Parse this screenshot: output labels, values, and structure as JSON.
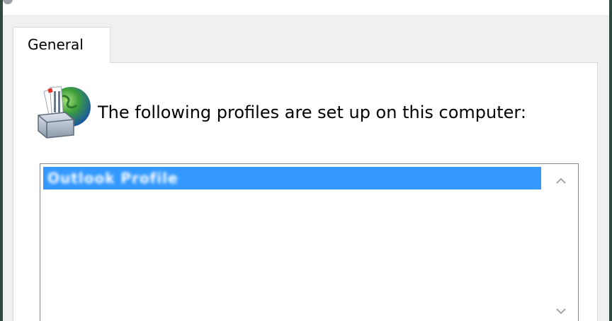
{
  "tab": {
    "label": "General"
  },
  "heading": "The following profiles are set up on this computer:",
  "profiles": {
    "selected": "Outlook Profile"
  },
  "icons": {
    "profiles": "mail-profiles-icon",
    "scroll_up": "chevron-up-icon",
    "scroll_down": "chevron-down-icon"
  },
  "colors": {
    "selection": "#3399ff",
    "panel": "#ffffff",
    "dialog": "#f0f0f0"
  }
}
